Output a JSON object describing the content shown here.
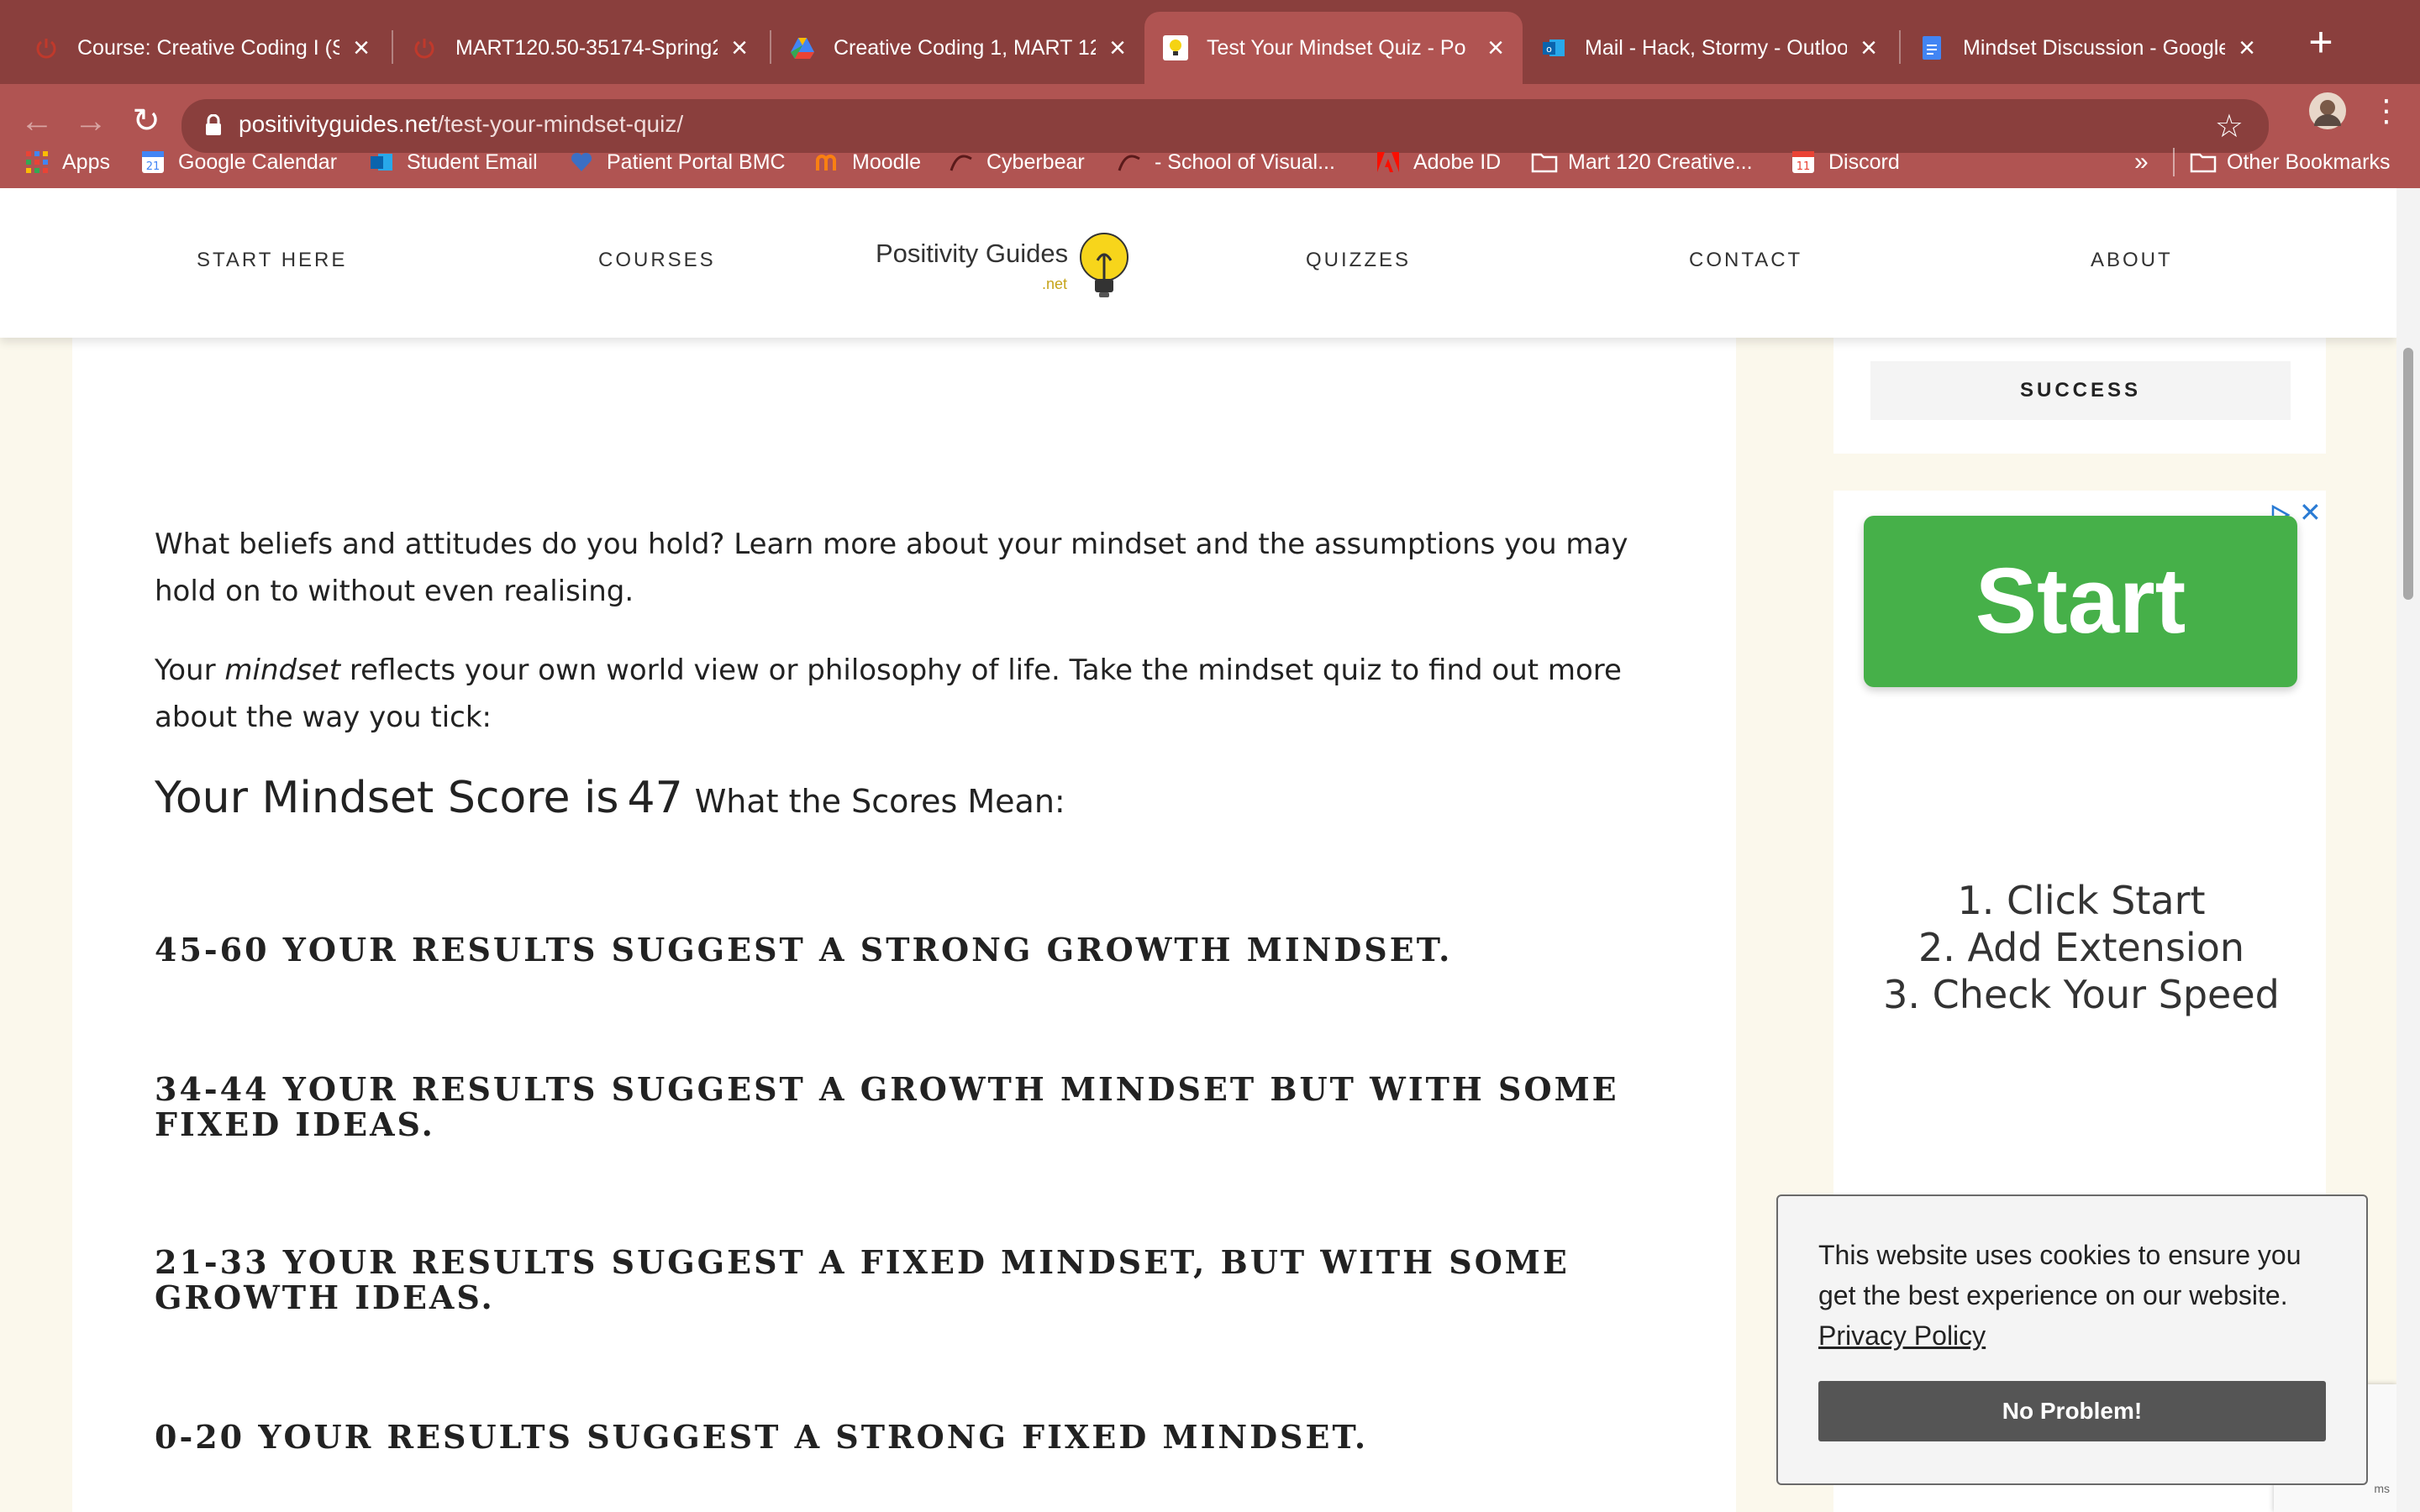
{
  "browser": {
    "tabs": [
      {
        "title": "Course: Creative Coding I (S",
        "favicon": "power-icon",
        "active": false
      },
      {
        "title": "MART120.50-35174-Spring2",
        "favicon": "power-icon",
        "active": false
      },
      {
        "title": "Creative Coding 1, MART 120",
        "favicon": "drive-icon",
        "active": false
      },
      {
        "title": "Test Your Mindset Quiz - Po",
        "favicon": "bulb-icon",
        "active": true
      },
      {
        "title": "Mail - Hack, Stormy - Outloo",
        "favicon": "outlook-icon",
        "active": false
      },
      {
        "title": "Mindset Discussion - Google",
        "favicon": "docs-icon",
        "active": false
      }
    ],
    "url_host": "positivityguides.net",
    "url_path": "/test-your-mindset-quiz/",
    "bookmarks": [
      {
        "label": "Apps",
        "icon": "apps-grid-icon"
      },
      {
        "label": "Google Calendar",
        "icon": "calendar-icon"
      },
      {
        "label": "Student Email",
        "icon": "outlook-icon"
      },
      {
        "label": "Patient Portal BMC",
        "icon": "heart-icon"
      },
      {
        "label": "Moodle",
        "icon": "moodle-icon"
      },
      {
        "label": "Cyberbear",
        "icon": "cyberbear-icon"
      },
      {
        "label": "- School of Visual...",
        "icon": "cyberbear-icon"
      },
      {
        "label": "Adobe ID",
        "icon": "adobe-icon"
      },
      {
        "label": "Mart 120 Creative...",
        "icon": "folder-icon"
      },
      {
        "label": "Discord",
        "icon": "calendar-icon"
      }
    ],
    "bookmarks_more": "»",
    "other_bookmarks": "Other Bookmarks"
  },
  "site": {
    "nav": {
      "start_here": "START HERE",
      "courses": "COURSES",
      "quizzes": "QUIZZES",
      "contact": "CONTACT",
      "about": "ABOUT"
    },
    "logo_text": "Positivity Guides",
    "logo_sub": ".net"
  },
  "sidebar": {
    "success_tab": "SUCCESS",
    "ad": {
      "button": "Start",
      "steps": [
        "1. Click Start",
        "2. Add Extension",
        "3. Check Your Speed"
      ]
    }
  },
  "article": {
    "intro": "What beliefs and attitudes do you hold? Learn more about your mindset and the assumptions you may hold on to without even realising.",
    "para2_before": "Your ",
    "para2_em": "mindset",
    "para2_after": " reflects your own world view or philosophy of life. Take the mindset quiz to find out more about the way you tick:",
    "score_label": "Your Mindset Score is",
    "score_value": "47",
    "scores_mean": "What the Scores Mean:",
    "results": [
      "45-60 YOUR RESULTS SUGGEST A STRONG GROWTH MINDSET.",
      "34-44 YOUR RESULTS SUGGEST A GROWTH MINDSET BUT WITH SOME FIXED IDEAS.",
      "21-33 YOUR RESULTS SUGGEST A FIXED MINDSET, BUT WITH SOME GROWTH IDEAS.",
      "0-20 YOUR RESULTS SUGGEST A STRONG FIXED MINDSET."
    ]
  },
  "cookie": {
    "text": "This website uses cookies to ensure you get the best experience on our website.",
    "link": "Privacy Policy",
    "button": "No Problem!"
  },
  "recaptcha": {
    "terms": "ms"
  }
}
